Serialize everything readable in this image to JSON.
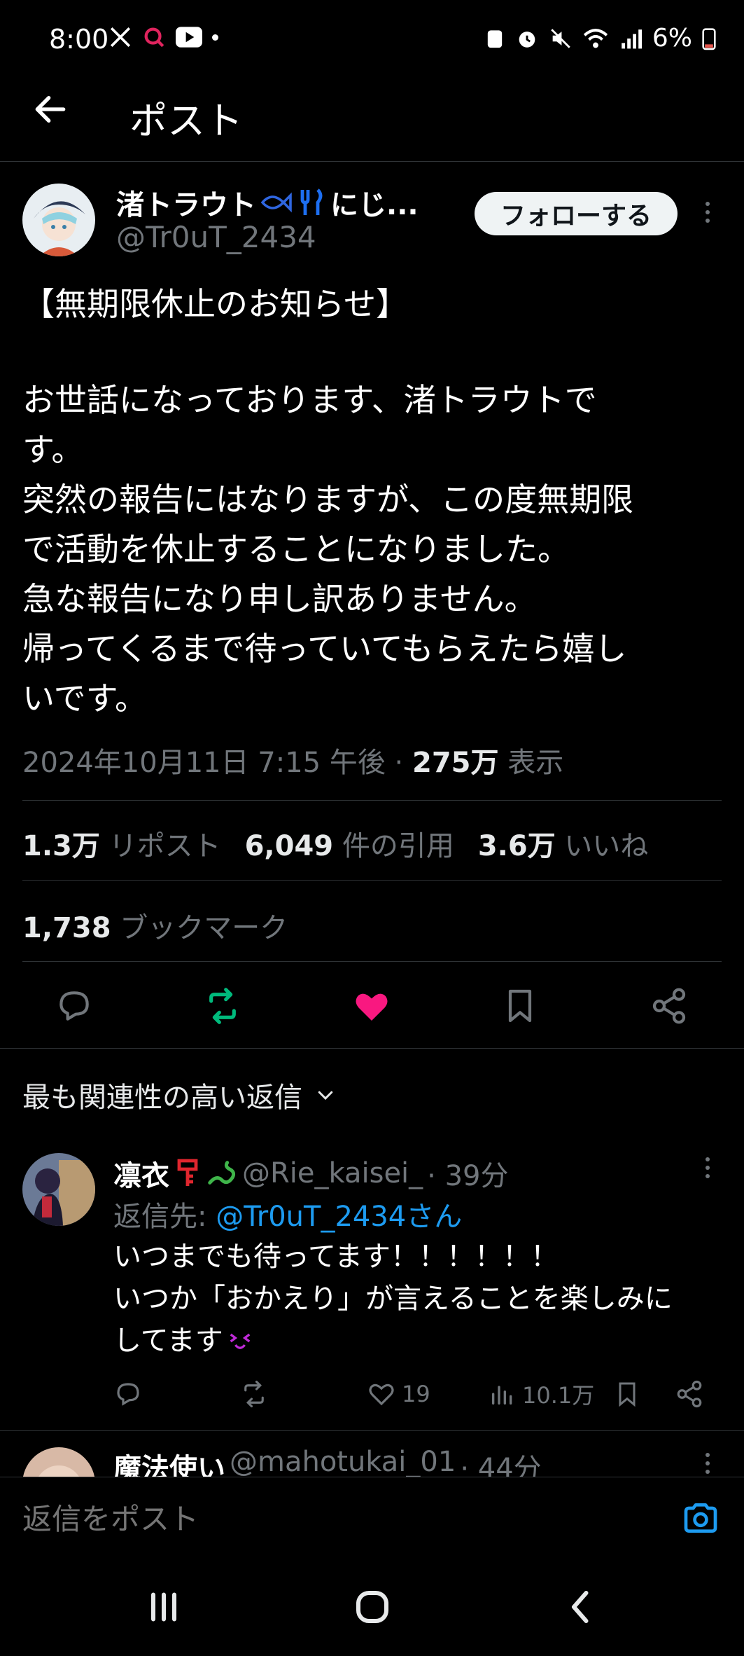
{
  "status_bar": {
    "time": "8:00",
    "battery": "6%"
  },
  "header": {
    "title": "ポスト"
  },
  "post": {
    "author_name": "渚トラウト",
    "author_name_suffix": "にじ...",
    "author_handle": "@Tr0uT_2434",
    "follow_label": "フォローする",
    "title": "【無期限休止のお知らせ】",
    "body": "お世話になっております、渚トラウトで\nす。\n突然の報告にはなりますが、この度無期限\nで活動を休止することになりました。\n急な報告になり申し訳ありません。\n帰ってくるまで待っていてもらえたら嬉し\nいです。",
    "date": "2024年10月11日 7:15 午後 · ",
    "views_count": "275万",
    "views_label": " 表示",
    "reposts_count": "1.3万",
    "reposts_label": " リポスト",
    "quotes_count": "6,049",
    "quotes_label": " 件の引用",
    "likes_count": "3.6万",
    "likes_label": " いいね",
    "bookmarks_count": "1,738",
    "bookmarks_label": " ブックマーク",
    "repost_color": "#00ba7c",
    "like_color": "#f91880"
  },
  "replies_header": "最も関連性の高い返信",
  "replies": [
    {
      "name": "凛衣",
      "handle": "@Rie_kaisei_",
      "time": "· 39分",
      "reply_to_prefix": "返信先: ",
      "reply_to_handle": "@Tr0uT_2434さん",
      "text": "いつまでも待ってます！！！！！！\nいつか「おかえり」が言えることを楽しみに\nしてます",
      "likes": "19",
      "views": "10.1万"
    },
    {
      "name": "魔法使い",
      "handle": "@mahotukai_01",
      "time": "· 44分"
    }
  ],
  "compose": {
    "placeholder": "返信をポスト"
  },
  "accent_color": "#1d9bf0"
}
